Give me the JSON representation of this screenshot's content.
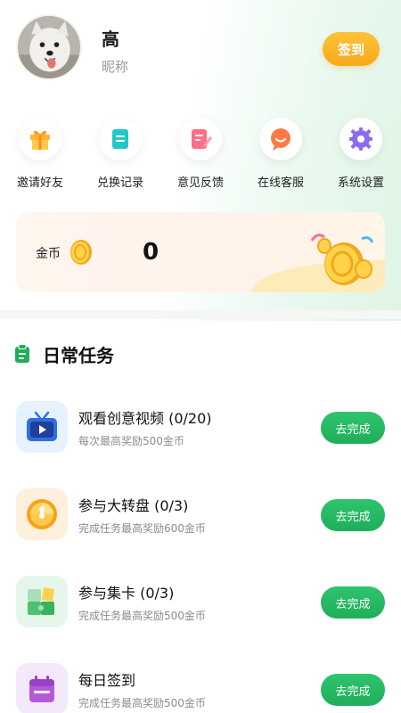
{
  "profile": {
    "name": "高",
    "nickname": "昵称",
    "checkin_label": "签到"
  },
  "quick_actions": [
    {
      "label": "邀请好友",
      "icon": "gift-icon"
    },
    {
      "label": "兑换记录",
      "icon": "record-icon"
    },
    {
      "label": "意见反馈",
      "icon": "feedback-icon"
    },
    {
      "label": "在线客服",
      "icon": "chat-icon"
    },
    {
      "label": "系统设置",
      "icon": "settings-icon"
    }
  ],
  "coins": {
    "label": "金币",
    "value": "0"
  },
  "daily_tasks": {
    "title": "日常任务",
    "button_label": "去完成",
    "items": [
      {
        "title": "观看创意视频 (0/20)",
        "desc": "每次最高奖励500金币",
        "icon": "video-tv-icon"
      },
      {
        "title": "参与大转盘 (0/3)",
        "desc": "完成任务最高奖励600金币",
        "icon": "wheel-icon"
      },
      {
        "title": "参与集卡 (0/3)",
        "desc": "完成任务最高奖励500金币",
        "icon": "puzzle-icon"
      },
      {
        "title": "每日签到",
        "desc": "完成任务最高奖励500金币",
        "icon": "calendar-icon"
      }
    ]
  },
  "colors": {
    "accent_green": "#1fae5a",
    "accent_orange": "#f8a81a"
  }
}
